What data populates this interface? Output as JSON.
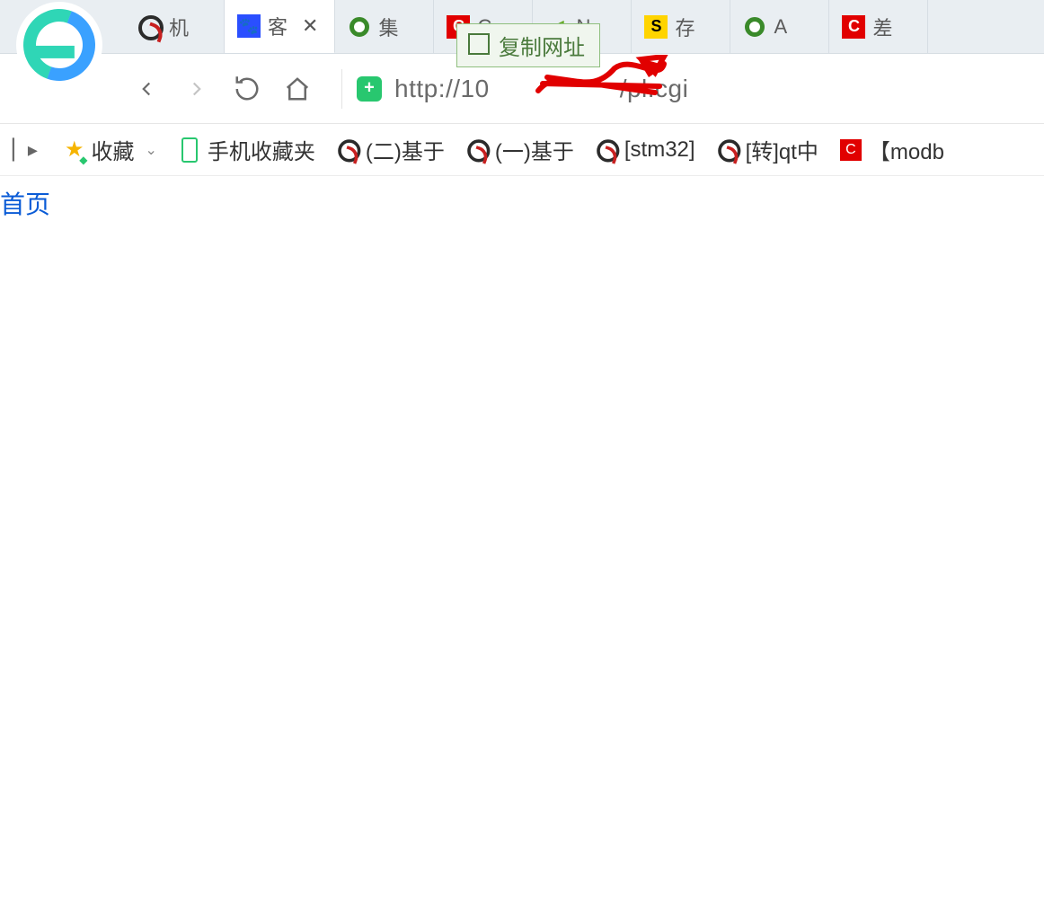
{
  "tabs": [
    {
      "icon": "blog",
      "title": "机"
    },
    {
      "icon": "paw",
      "title": "客",
      "active": true
    },
    {
      "icon": "ring-green",
      "title": "集"
    },
    {
      "icon": "csdn",
      "title": "C"
    },
    {
      "icon": "nvidia",
      "title": "N"
    },
    {
      "icon": "sogou",
      "title": "存"
    },
    {
      "icon": "ring-green",
      "title": "A"
    },
    {
      "icon": "csdn",
      "title": "差"
    }
  ],
  "tooltip": {
    "label": "复制网址"
  },
  "toolbar": {
    "url_prefix": "http://10",
    "url_suffix": "/pl.cgi"
  },
  "bookmarks": {
    "fav_label": "收藏",
    "mobile_label": "手机收藏夹",
    "items": [
      {
        "icon": "blog",
        "label": "(二)基于"
      },
      {
        "icon": "blog",
        "label": "(一)基于"
      },
      {
        "icon": "blog",
        "label": "[stm32]"
      },
      {
        "icon": "blog",
        "label": "[转]qt中"
      },
      {
        "icon": "csdn",
        "label": "【modb"
      }
    ]
  },
  "page": {
    "home_link": "首页"
  }
}
